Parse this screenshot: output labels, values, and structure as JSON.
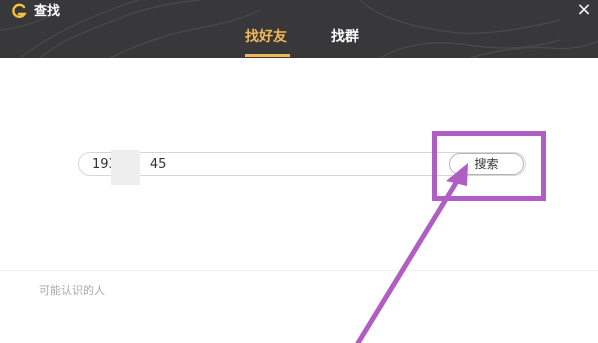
{
  "window": {
    "title": "查找",
    "close_label": "×"
  },
  "tabs": [
    {
      "label": "找好友",
      "active": true
    },
    {
      "label": "找群",
      "active": false
    }
  ],
  "search": {
    "value_prefix": "193",
    "value_suffix": "45",
    "button_label": "搜索"
  },
  "section": {
    "label": "可能认识的人"
  },
  "colors": {
    "titlebar_bg": "#38383a",
    "active_tab": "#f0b85a",
    "logo": "#f5c33b",
    "annotation": "#b05ec4"
  }
}
